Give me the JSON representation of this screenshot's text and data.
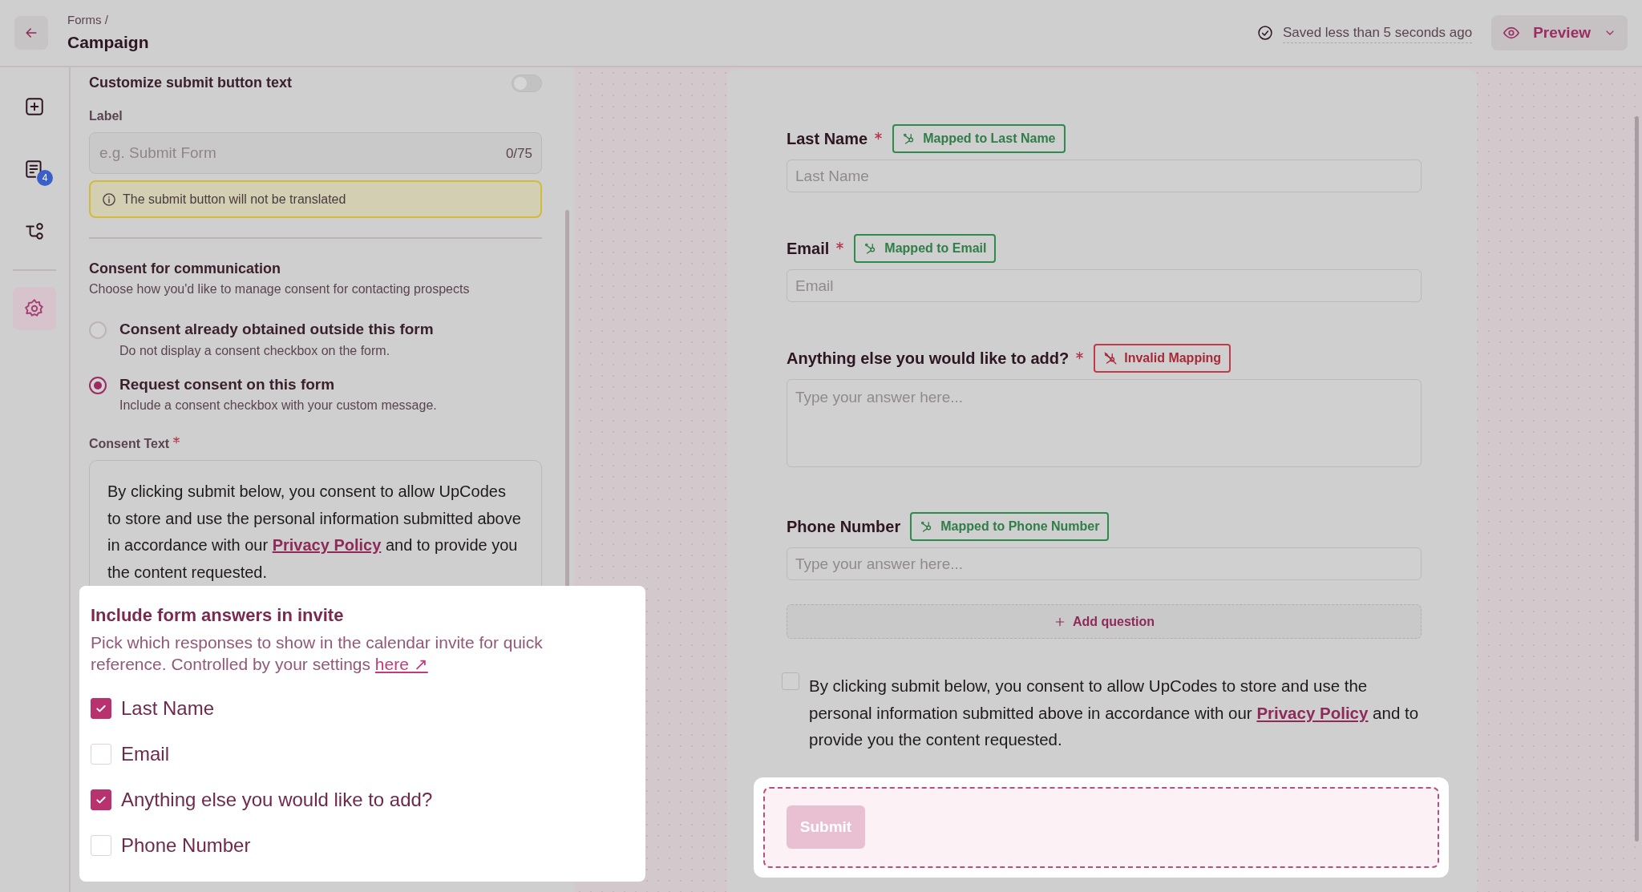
{
  "header": {
    "breadcrumb": "Forms /",
    "title": "Campaign",
    "save_status": "Saved less than 5 seconds ago",
    "preview_button": "Preview"
  },
  "rail": {
    "items": [
      {
        "kind": "add",
        "selected": false
      },
      {
        "kind": "responses",
        "badge": "4",
        "selected": false
      },
      {
        "kind": "flow",
        "selected": false
      },
      {
        "kind": "settings",
        "selected": true
      }
    ]
  },
  "settings_panel": {
    "customize_title": "Customize submit button text",
    "customize_on": false,
    "label_title": "Label",
    "label_placeholder": "e.g. Submit Form",
    "label_counter": "0/75",
    "notice": "The submit button will not be translated",
    "consent_title": "Consent for communication",
    "consent_subtitle": "Choose how you'd like to manage consent for contacting prospects",
    "consent_options": [
      {
        "label": "Consent already obtained outside this form",
        "description": "Do not display a consent checkbox on the form.",
        "selected": false
      },
      {
        "label": "Request consent on this form",
        "description": "Include a consent checkbox with your custom message.",
        "selected": true
      }
    ],
    "consent_text_label": "Consent Text",
    "consent_text_required": true,
    "consent_text": {
      "before": "By clicking submit below, you consent to allow UpCodes to store and use the personal information submitted above in accordance with our",
      "link": "Privacy Policy",
      "after": "and to provide you the content requested."
    }
  },
  "invite_popover": {
    "title": "Include form answers in invite",
    "description": "Pick which responses to show in the calendar invite for quick reference. Controlled by your settings",
    "link": "here ↗",
    "items": [
      {
        "label": "Last Name",
        "checked": true
      },
      {
        "label": "Email",
        "checked": false
      },
      {
        "label": "Anything else you would like to add?",
        "checked": true
      },
      {
        "label": "Phone Number",
        "checked": false
      }
    ]
  },
  "form": {
    "questions": [
      {
        "kind": "input",
        "label": "Last Name",
        "required": true,
        "mapping": {
          "text": "Mapped to Last Name",
          "valid": true
        },
        "placeholder": "Last Name"
      },
      {
        "kind": "input",
        "label": "Email",
        "required": true,
        "mapping": {
          "text": "Mapped to Email",
          "valid": true
        },
        "placeholder": "Email"
      },
      {
        "kind": "textarea",
        "label": "Anything else you would like to add?",
        "required": true,
        "mapping": {
          "text": "Invalid Mapping",
          "valid": false
        },
        "placeholder": "Type your answer here..."
      },
      {
        "kind": "input",
        "label": "Phone Number",
        "required": false,
        "mapping": {
          "text": "Mapped to Phone Number",
          "valid": true
        },
        "placeholder": "Type your answer here..."
      }
    ],
    "add_question": "Add question",
    "consent": {
      "checked": false,
      "before": "By clicking submit below, you consent to allow UpCodes to store and use the personal information submitted above in accordance with our",
      "link": "Privacy Policy",
      "after": "and to provide you the content requested."
    },
    "submit_button": "Submit"
  }
}
